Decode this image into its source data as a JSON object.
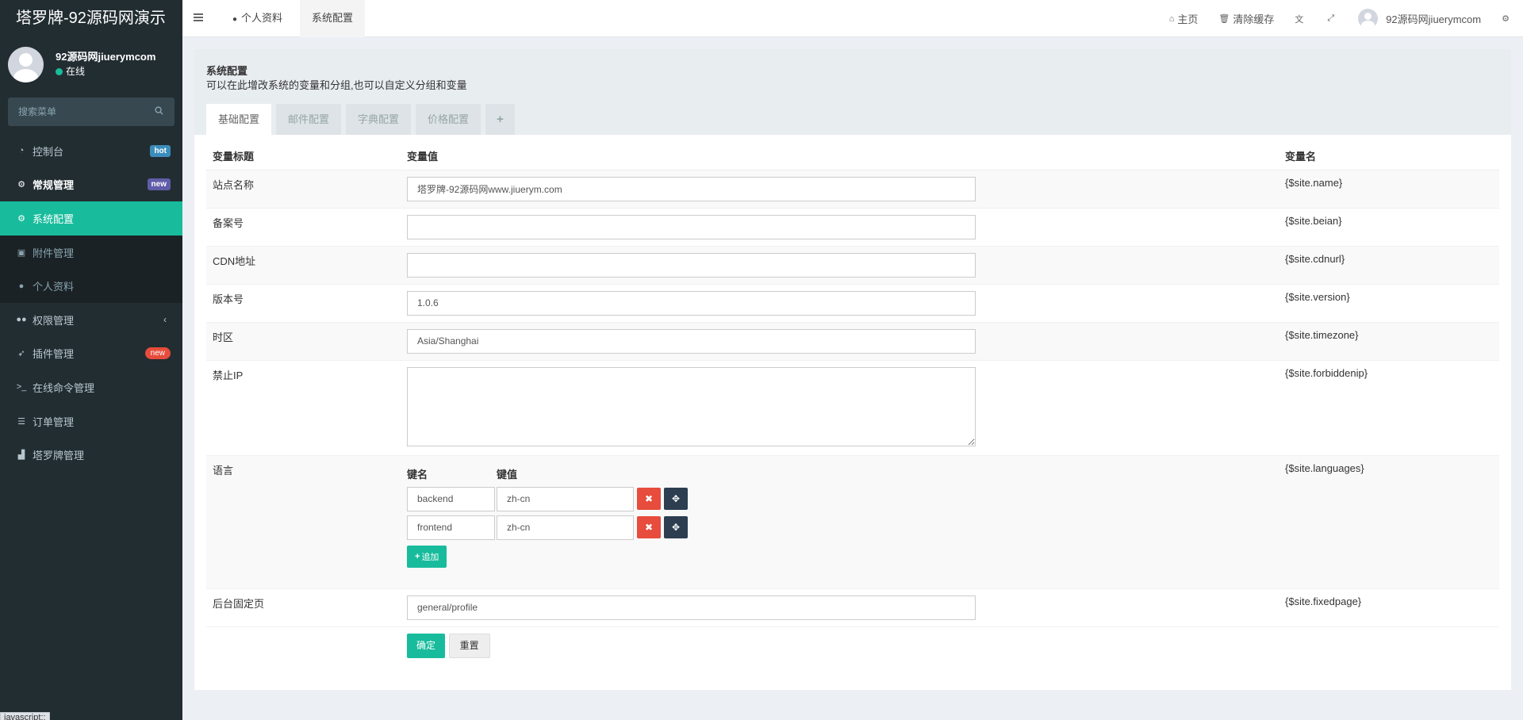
{
  "sidebar": {
    "logo": "塔罗牌-92源码网演示",
    "user": {
      "name": "92源码网jiuerymcom",
      "status": "在线"
    },
    "search_placeholder": "搜索菜单",
    "items": [
      {
        "label": "控制台",
        "badge": "hot"
      },
      {
        "label": "常规管理",
        "badge": "new"
      },
      {
        "label": "系统配置"
      },
      {
        "label": "附件管理"
      },
      {
        "label": "个人资料"
      },
      {
        "label": "权限管理"
      },
      {
        "label": "插件管理",
        "badge": "new"
      },
      {
        "label": "在线命令管理"
      },
      {
        "label": "订单管理"
      },
      {
        "label": "塔罗牌管理"
      }
    ]
  },
  "topbar": {
    "tabs": [
      "个人资料",
      "系统配置"
    ],
    "home": "主页",
    "clear_cache": "清除缓存",
    "username": "92源码网jiuerymcom"
  },
  "panel": {
    "title": "系统配置",
    "description": "可以在此增改系统的变量和分组,也可以自定义分组和变量",
    "tabs": [
      "基础配置",
      "邮件配置",
      "字典配置",
      "价格配置",
      "+"
    ],
    "headers": {
      "title": "变量标题",
      "value": "变量值",
      "name": "变量名"
    },
    "rows": [
      {
        "title": "站点名称",
        "value": "塔罗牌-92源码网www.jiuerym.com",
        "name": "{$site.name}"
      },
      {
        "title": "备案号",
        "value": "",
        "name": "{$site.beian}"
      },
      {
        "title": "CDN地址",
        "value": "",
        "name": "{$site.cdnurl}"
      },
      {
        "title": "版本号",
        "value": "1.0.6",
        "name": "{$site.version}"
      },
      {
        "title": "时区",
        "value": "Asia/Shanghai",
        "name": "{$site.timezone}"
      },
      {
        "title": "禁止IP",
        "value": "",
        "name": "{$site.forbiddenip}"
      },
      {
        "title": "语言",
        "name": "{$site.languages}"
      },
      {
        "title": "后台固定页",
        "value": "general/profile",
        "name": "{$site.fixedpage}"
      }
    ],
    "languages": {
      "key_header": "键名",
      "value_header": "键值",
      "pairs": [
        {
          "key": "backend",
          "value": "zh-cn"
        },
        {
          "key": "frontend",
          "value": "zh-cn"
        }
      ],
      "add_label": "追加"
    },
    "submit_label": "确定",
    "reset_label": "重置"
  },
  "status_tip": "javascript:;"
}
